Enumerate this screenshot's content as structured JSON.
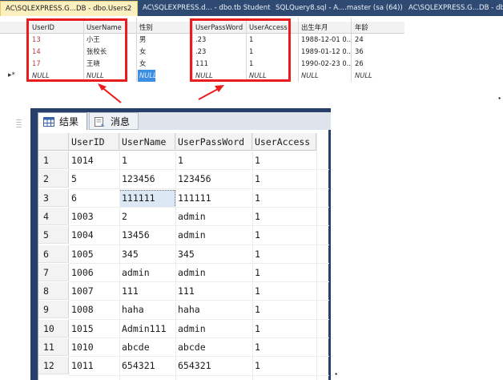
{
  "tabs": [
    {
      "label": "AC\\SQLEXPRESS.G...DB - dbo.Users2",
      "active": true,
      "close": "✕"
    },
    {
      "label": "AC\\SQLEXPRESS.d... - dbo.tb Student",
      "active": false
    },
    {
      "label": "SQLQuery8.sql - A....master (sa (64))",
      "active": false
    },
    {
      "label": "AC\\SQLEXPRESS.G...DB - dbo.U",
      "active": false
    }
  ],
  "top_grid": {
    "headers": [
      "UserID",
      "UserName",
      "性别",
      "UserPassWord",
      "UserAccess",
      "出生年月",
      "年龄"
    ],
    "rows": [
      [
        "13",
        "小王",
        "男",
        ".23",
        "1",
        "1988-12-01 0...",
        "24"
      ],
      [
        "14",
        "张校长",
        "女",
        ".23",
        "1",
        "1989-01-12 0...",
        "36"
      ],
      [
        "17",
        "王晓",
        "女",
        "111",
        "1",
        "1990-02-23 0...",
        "26"
      ]
    ],
    "null_row": [
      "NULL",
      "NULL",
      "NULL",
      "NULL",
      "NULL",
      "NULL",
      "NULL"
    ],
    "row_marker": "▸*"
  },
  "results_tabs": [
    {
      "label": "结果",
      "icon": "grid-icon",
      "active": true
    },
    {
      "label": "消息",
      "icon": "message-icon",
      "active": false
    }
  ],
  "results": {
    "headers": [
      "UserID",
      "UserName",
      "UserPassWord",
      "UserAccess"
    ],
    "rows": [
      [
        "1014",
        "1",
        "1",
        "1"
      ],
      [
        "5",
        "123456",
        "123456",
        "1"
      ],
      [
        "6",
        "111111",
        "111111",
        "1"
      ],
      [
        "1003",
        "2",
        "admin",
        "1"
      ],
      [
        "1004",
        "13456",
        "admin",
        "1"
      ],
      [
        "1005",
        "345",
        "345",
        "1"
      ],
      [
        "1006",
        "admin",
        "admin",
        "1"
      ],
      [
        "1007",
        "111",
        "111",
        "1"
      ],
      [
        "1008",
        "haha",
        "haha",
        "1"
      ],
      [
        "1015",
        "Admin111",
        "admin",
        "1"
      ],
      [
        "1010",
        "abcde",
        "abcde",
        "1"
      ],
      [
        "1011",
        "654321",
        "654321",
        "1"
      ]
    ],
    "row_numbers": [
      "1",
      "2",
      "3",
      "4",
      "5",
      "6",
      "7",
      "8",
      "9",
      "10",
      "11",
      "12"
    ]
  },
  "colors": {
    "highlight_red": "#ea1c1c",
    "tab_bar": "#2f4a72",
    "active_tab": "#fcf0c0",
    "null_select": "#3d8ee0"
  }
}
